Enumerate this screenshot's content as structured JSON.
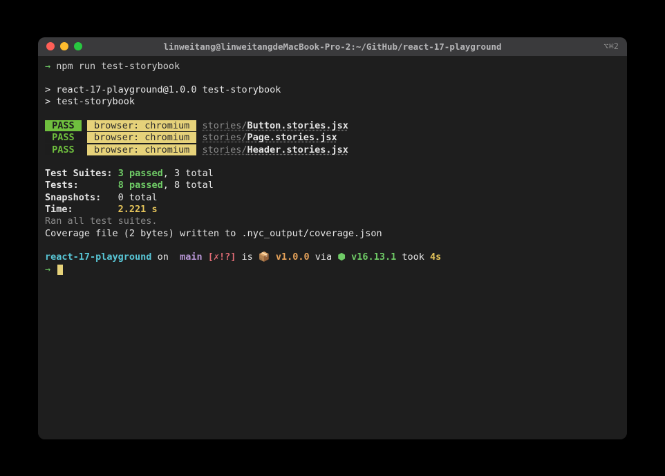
{
  "title_bar": {
    "title": "linweitang@linweitangdeMacBook-Pro-2:~/GitHub/react-17-playground",
    "session": "⌥⌘2"
  },
  "content": {
    "prompt_arrow": "→",
    "command1": "npm run test-storybook",
    "script_header": "> react-17-playground@1.0.0 test-storybook",
    "script_sub": "> test-storybook",
    "results": [
      {
        "pass": " PASS ",
        "browser": " browser: chromium ",
        "dir": "stories/",
        "file": "Button.stories.jsx",
        "inverted": false
      },
      {
        "pass": " PASS ",
        "browser": " browser: chromium ",
        "dir": "stories/",
        "file": "Page.stories.jsx",
        "inverted": true
      },
      {
        "pass": " PASS ",
        "browser": " browser: chromium ",
        "dir": "stories/",
        "file": "Header.stories.jsx",
        "inverted": true
      }
    ],
    "summary": {
      "suites_label": "Test Suites:",
      "suites_passed": "3 passed",
      "suites_total": ", 3 total",
      "tests_label": "Tests:",
      "tests_passed": "8 passed",
      "tests_total": ", 8 total",
      "snapshots_label": "Snapshots:",
      "snapshots_value": "0 total",
      "time_label": "Time:",
      "time_value": "2.221 s",
      "ran": "Ran all test suites.",
      "coverage": "Coverage file (2 bytes) written to .nyc_output/coverage.json"
    },
    "powerline": {
      "dir": "react-17-playground",
      "on": " on ",
      "git_icon": "",
      "branch": " main ",
      "status": "[✗!?]",
      "is": " is ",
      "pkg_icon": "📦",
      "pkg_ver": " v1.0.0",
      "via": " via ",
      "node_dot": "⬢",
      "node_ver": " v16.13.1",
      "took_label": " took ",
      "took_val": "4s"
    }
  }
}
